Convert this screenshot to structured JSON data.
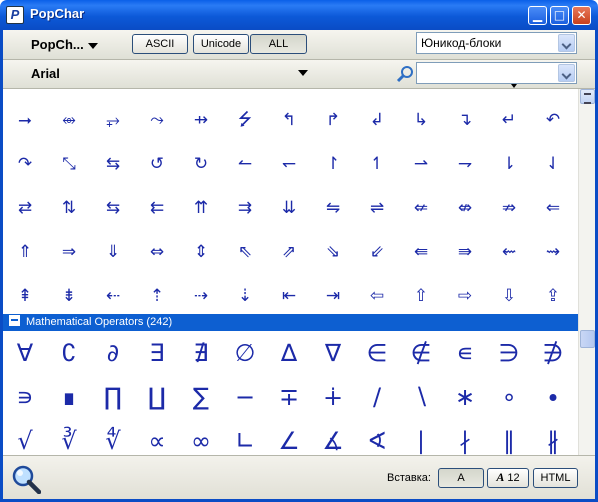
{
  "window": {
    "app_icon_letter": "P",
    "title": "PopChar",
    "minimize": "▁",
    "maximize": "□",
    "close": "✕"
  },
  "toolbar": {
    "popchar_label": "PopCh...",
    "encoding_buttons": [
      "ASCII",
      "Unicode",
      "ALL"
    ],
    "active_encoding": "ALL",
    "blocks_select_value": "Юникод-блоки",
    "font_name": "Arial",
    "search_value": ""
  },
  "arrows_section": {
    "rows": [
      [
        "⭢",
        "⥈",
        "⥅",
        "⤳",
        "⇸",
        "⭍",
        "↰",
        "↱",
        "↲",
        "↳",
        "↴",
        "↵",
        "↶"
      ],
      [
        "↷",
        "⤡",
        "⇆",
        "↺",
        "↻",
        "↼",
        "↽",
        "↾",
        "↿",
        "⇀",
        "⇁",
        "⇂",
        "⇃"
      ],
      [
        "⇄",
        "⇅",
        "⇆",
        "⇇",
        "⇈",
        "⇉",
        "⇊",
        "⇋",
        "⇌",
        "⇍",
        "⇎",
        "⇏",
        "⇐"
      ],
      [
        "⇑",
        "⇒",
        "⇓",
        "⇔",
        "⇕",
        "⇖",
        "⇗",
        "⇘",
        "⇙",
        "⇚",
        "⇛",
        "⇜",
        "⇝"
      ],
      [
        "⇞",
        "⇟",
        "⇠",
        "⇡",
        "⇢",
        "⇣",
        "⇤",
        "⇥",
        "⇦",
        "⇧",
        "⇨",
        "⇩",
        "⇪"
      ]
    ]
  },
  "math_section": {
    "header": "Mathematical Operators (242)",
    "rows": [
      [
        "∀",
        "∁",
        "∂",
        "∃",
        "∄",
        "∅",
        "∆",
        "∇",
        "∈",
        "∉",
        "∊",
        "∋",
        "∌"
      ],
      [
        "∍",
        "∎",
        "∏",
        "∐",
        "∑",
        "−",
        "∓",
        "∔",
        "∕",
        "∖",
        "∗",
        "∘",
        "∙"
      ],
      [
        "√",
        "∛",
        "∜",
        "∝",
        "∞",
        "∟",
        "∠",
        "∡",
        "∢",
        "∣",
        "∤",
        "∥",
        "∦"
      ]
    ]
  },
  "statusbar": {
    "insert_label": "Вставка:",
    "char_button": "A",
    "font_size_button": "12",
    "html_button": "HTML"
  },
  "colors": {
    "title_bar": "#0a5fe8",
    "section_header": "#0d5fd1",
    "glyph": "#1c2aa8"
  }
}
